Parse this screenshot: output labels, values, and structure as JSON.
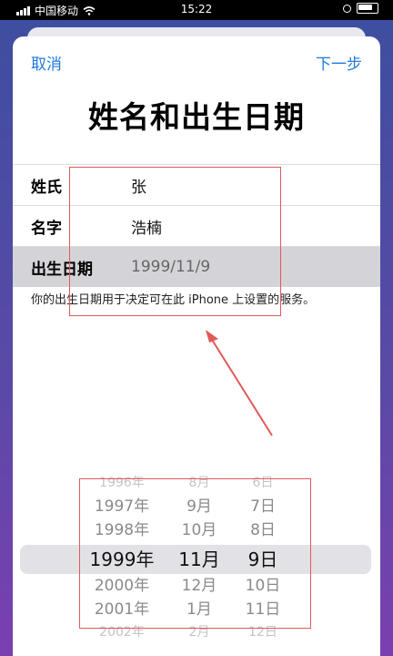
{
  "status_bar": {
    "carrier": "中国移动",
    "time": "15:22"
  },
  "nav": {
    "cancel_label": "取消",
    "next_label": "下一步"
  },
  "title": "姓名和出生日期",
  "form": {
    "rows": [
      {
        "label": "姓氏",
        "value": "张"
      },
      {
        "label": "名字",
        "value": "浩楠"
      },
      {
        "label": "出生日期",
        "value": "1999/11/9"
      }
    ],
    "hint": "你的出生日期用于决定可在此 iPhone 上设置的服务。"
  },
  "picker": {
    "years": [
      "1996年",
      "1997年",
      "1998年",
      "1999年",
      "2000年",
      "2001年",
      "2002年"
    ],
    "months": [
      "8月",
      "9月",
      "10月",
      "11月",
      "12月",
      "1月",
      "2月"
    ],
    "days": [
      "6日",
      "7日",
      "8日",
      "9日",
      "10日",
      "11日",
      "12日"
    ],
    "selected_index": 3
  },
  "colors": {
    "accent": "#1f7ae0",
    "annotation": "#e05a5a"
  }
}
